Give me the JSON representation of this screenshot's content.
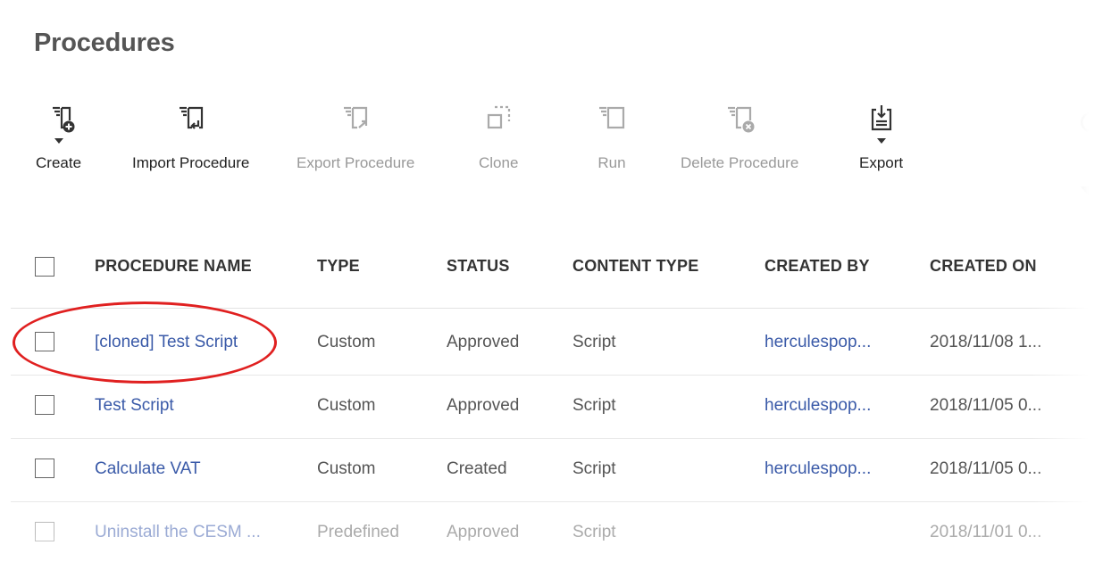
{
  "page": {
    "title": "Procedures"
  },
  "toolbar": {
    "create": "Create",
    "import": "Import Procedure",
    "export_procedure": "Export Procedure",
    "clone": "Clone",
    "run": "Run",
    "delete": "Delete Procedure",
    "export": "Export"
  },
  "table": {
    "headers": {
      "name": "PROCEDURE NAME",
      "type": "TYPE",
      "status": "STATUS",
      "content_type": "CONTENT TYPE",
      "created_by": "CREATED BY",
      "created_on": "CREATED ON"
    },
    "rows": [
      {
        "name": "[cloned] Test Script",
        "type": "Custom",
        "status": "Approved",
        "content_type": "Script",
        "created_by": "herculespop...",
        "created_on": "2018/11/08 1..."
      },
      {
        "name": "Test Script",
        "type": "Custom",
        "status": "Approved",
        "content_type": "Script",
        "created_by": "herculespop...",
        "created_on": "2018/11/05 0..."
      },
      {
        "name": "Calculate VAT",
        "type": "Custom",
        "status": "Created",
        "content_type": "Script",
        "created_by": "herculespop...",
        "created_on": "2018/11/05 0..."
      },
      {
        "name": "Uninstall the CESM ...",
        "type": "Predefined",
        "status": "Approved",
        "content_type": "Script",
        "created_by": "",
        "created_on": "2018/11/01 0..."
      }
    ]
  },
  "colors": {
    "link": "#3a5aa8",
    "highlight": "#e02020",
    "disabled": "#999999"
  }
}
